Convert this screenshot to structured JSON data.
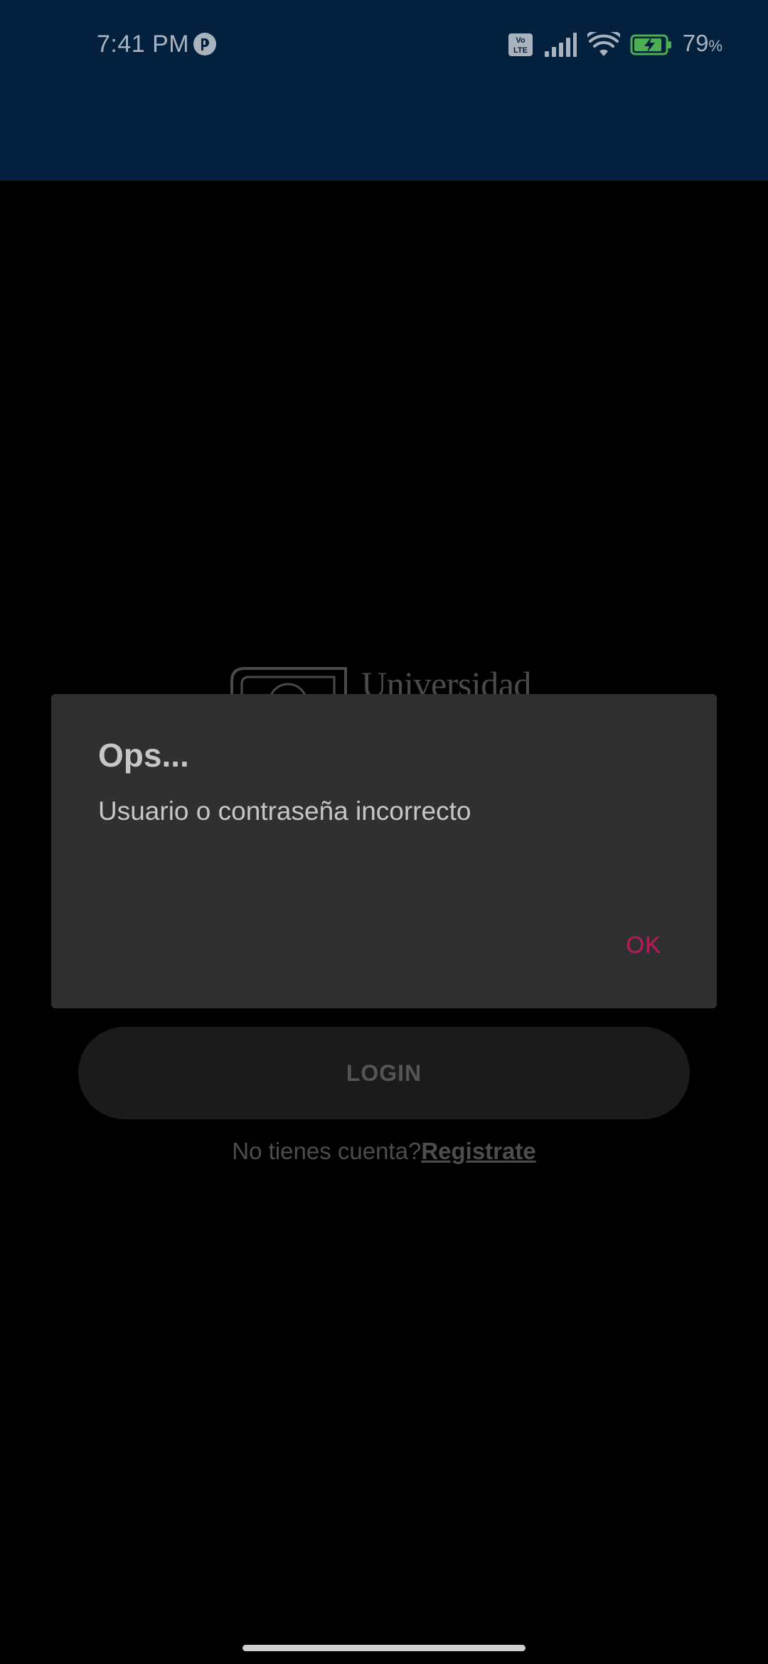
{
  "status_bar": {
    "time": "7:41 PM",
    "battery_level": "79",
    "battery_unit": "%",
    "icons": [
      "notification-app-icon",
      "volte-icon",
      "signal-icon",
      "wifi-icon",
      "battery-charging-icon"
    ]
  },
  "background": {
    "logo_text": "Universidad",
    "login_label": "LOGIN",
    "register_prompt": "No tienes cuenta?",
    "register_link": "Registrate"
  },
  "dialog": {
    "title": "Ops...",
    "message": "Usuario o contraseña incorrecto",
    "ok_label": "OK"
  },
  "colors": {
    "topbar": "#03203f",
    "dialog_bg": "#303030",
    "accent": "#c2185b",
    "battery_fill": "#4caf50"
  }
}
